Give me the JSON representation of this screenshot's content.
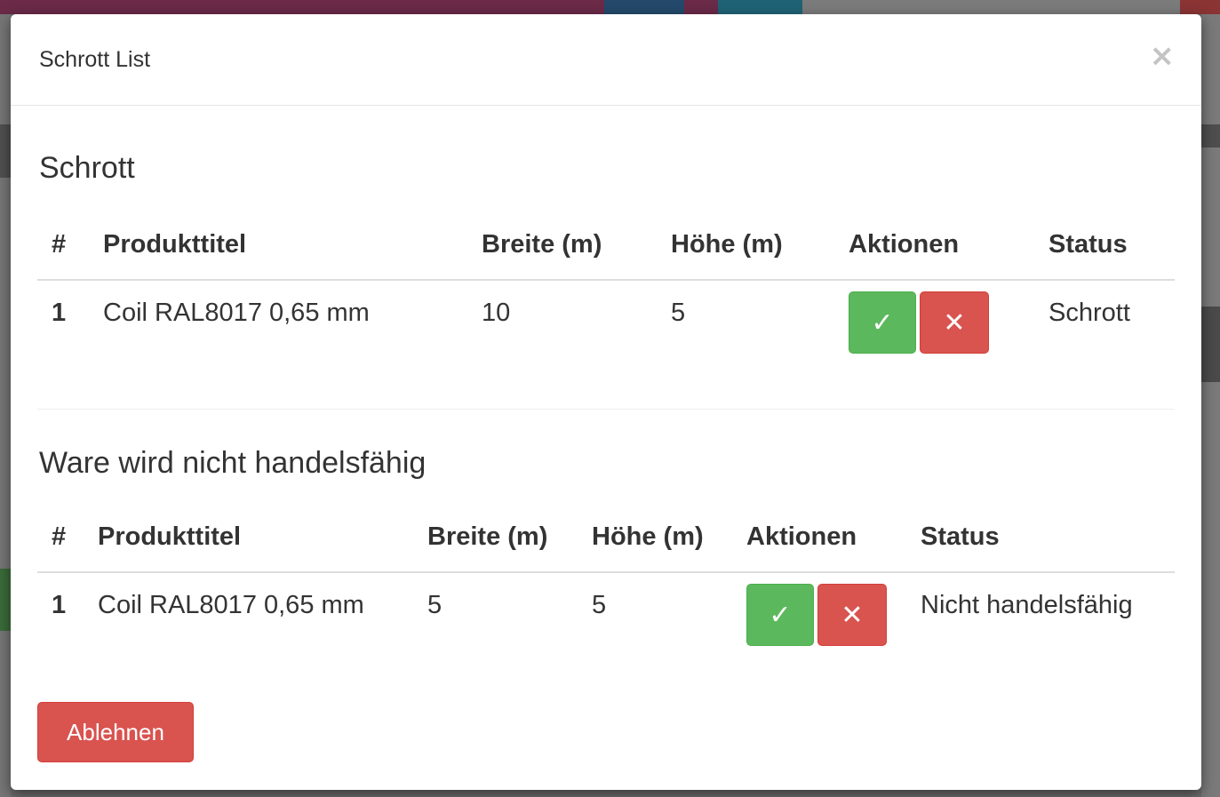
{
  "modal": {
    "title": "Schrott List",
    "close_label": "×"
  },
  "section_scrap": {
    "title": "Schrott",
    "columns": [
      "#",
      "Produkttitel",
      "Breite (m)",
      "Höhe (m)",
      "Aktionen",
      "Status"
    ],
    "rows": [
      {
        "num": "1",
        "product": "Coil RAL8017 0,65 mm",
        "width": "10",
        "height": "5",
        "status": "Schrott"
      }
    ]
  },
  "section_unsellable": {
    "title": "Ware wird nicht handelsfähig",
    "columns": [
      "#",
      "Produkttitel",
      "Breite (m)",
      "Höhe (m)",
      "Aktionen",
      "Status"
    ],
    "rows": [
      {
        "num": "1",
        "product": "Coil RAL8017 0,65 mm",
        "width": "5",
        "height": "5",
        "status": "Nicht handelsfähig"
      }
    ]
  },
  "actions": {
    "approve_icon": "✓",
    "reject_icon": "✕"
  },
  "footer": {
    "reject_button": "Ablehnen"
  },
  "colors": {
    "success": "#5cb85c",
    "danger": "#d9534f"
  }
}
